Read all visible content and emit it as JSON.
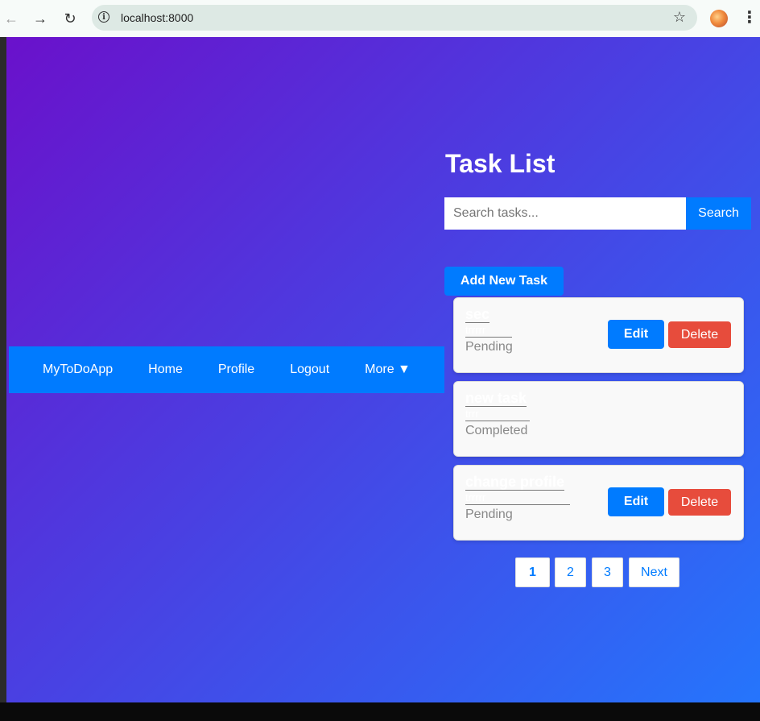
{
  "browser": {
    "url": "localhost:8000",
    "back_icon": "arrow-left-icon",
    "forward_icon": "arrow-right-icon",
    "reload_icon": "reload-icon",
    "info_icon": "info-icon",
    "bookmark_icon": "star-icon",
    "menu_icon": "kebab-menu-icon"
  },
  "navbar": {
    "brand": "MyToDoApp",
    "links": [
      "Home",
      "Profile",
      "Logout"
    ],
    "more": "More ▼",
    "color": "#007bff"
  },
  "task_panel": {
    "title": "Task List",
    "search_placeholder": "Search tasks...",
    "search_button": "Search",
    "add_button": "Add New Task",
    "tasks": [
      {
        "name": "sec",
        "description": "trrrrr",
        "status": "Pending",
        "edit": "Edit",
        "delete": "Delete"
      },
      {
        "name": "new task",
        "description": "trrr",
        "status": "Completed"
      },
      {
        "name": "change profile",
        "description": "trrrrr",
        "status": "Pending",
        "edit": "Edit",
        "delete": "Delete"
      }
    ],
    "pagination": [
      "1",
      "2",
      "3"
    ],
    "next": "Next",
    "current_page": "1"
  },
  "colors": {
    "gradient_start": "#6a11cb",
    "gradient_end": "#2575fc",
    "primary": "#007bff",
    "danger": "#e74c3c"
  }
}
